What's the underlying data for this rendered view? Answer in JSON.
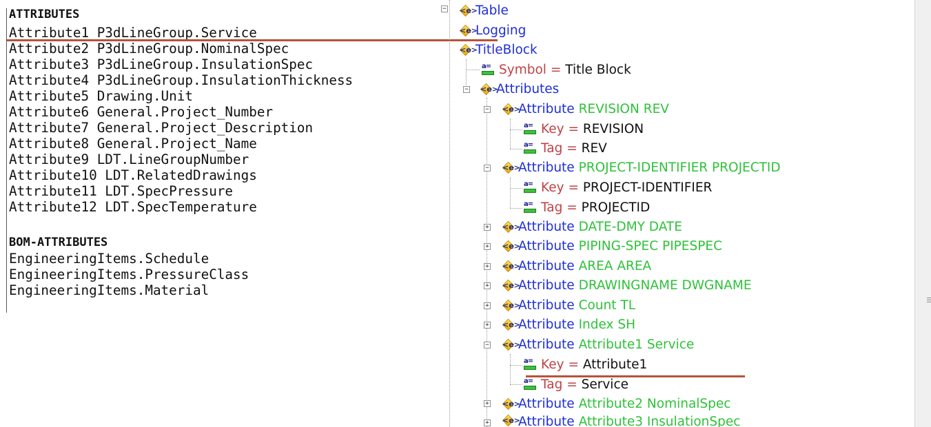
{
  "left_panel": {
    "heading_attributes": "ATTRIBUTES",
    "attributes": [
      "Attribute1 P3dLineGroup.Service",
      "Attribute2 P3dLineGroup.NominalSpec",
      "Attribute3 P3dLineGroup.InsulationSpec",
      "Attribute4 P3dLineGroup.InsulationThickness",
      "Attribute5 Drawing.Unit",
      "Attribute6 General.Project_Number",
      "Attribute7 General.Project_Description",
      "Attribute8 General.Project_Name",
      "Attribute9 LDT.LineGroupNumber",
      "Attribute10 LDT.RelatedDrawings",
      "Attribute11 LDT.SpecPressure",
      "Attribute12 LDT.SpecTemperature"
    ],
    "heading_bom": "BOM-ATTRIBUTES",
    "bom_attributes": [
      "EngineeringItems.Schedule",
      "EngineeringItems.PressureClass",
      "EngineeringItems.Material"
    ]
  },
  "tree": {
    "table": "Table",
    "logging": "Logging",
    "titleblock": "TitleBlock",
    "symbol": {
      "key": "Symbol",
      "eq": "=",
      "value": "Title Block"
    },
    "attributes": "Attributes",
    "attribute_word": "Attribute",
    "eq": "=",
    "key_label": "Key",
    "tag_label": "Tag",
    "nodes": [
      {
        "name": "REVISION REV",
        "key": "REVISION",
        "tag": "REV",
        "expanded": true
      },
      {
        "name": "PROJECT-IDENTIFIER PROJECTID",
        "key": "PROJECT-IDENTIFIER",
        "tag": "PROJECTID",
        "expanded": true
      },
      {
        "name": "DATE-DMY DATE",
        "expanded": false
      },
      {
        "name": "PIPING-SPEC PIPESPEC",
        "expanded": false
      },
      {
        "name": "AREA AREA",
        "expanded": false
      },
      {
        "name": "DRAWINGNAME DWGNAME",
        "expanded": false
      },
      {
        "name": "Count TL",
        "expanded": false
      },
      {
        "name": "Index SH",
        "expanded": false
      },
      {
        "name": "Attribute1 Service",
        "key": "Attribute1",
        "tag": "Service",
        "expanded": true
      },
      {
        "name": "Attribute2 NominalSpec",
        "expanded": false
      },
      {
        "name": "Attribute3 InsulationSpec",
        "expanded": false
      }
    ]
  },
  "colors": {
    "element_blue": "#1f2fd8",
    "property_red": "#c04246",
    "value_green": "#2fc13a",
    "highlight_underline": "#b5533a"
  },
  "icons": {
    "element": "xml-element-icon",
    "attribute": "xml-attribute-icon",
    "expand": "plus-expander-icon",
    "collapse": "minus-expander-icon"
  }
}
